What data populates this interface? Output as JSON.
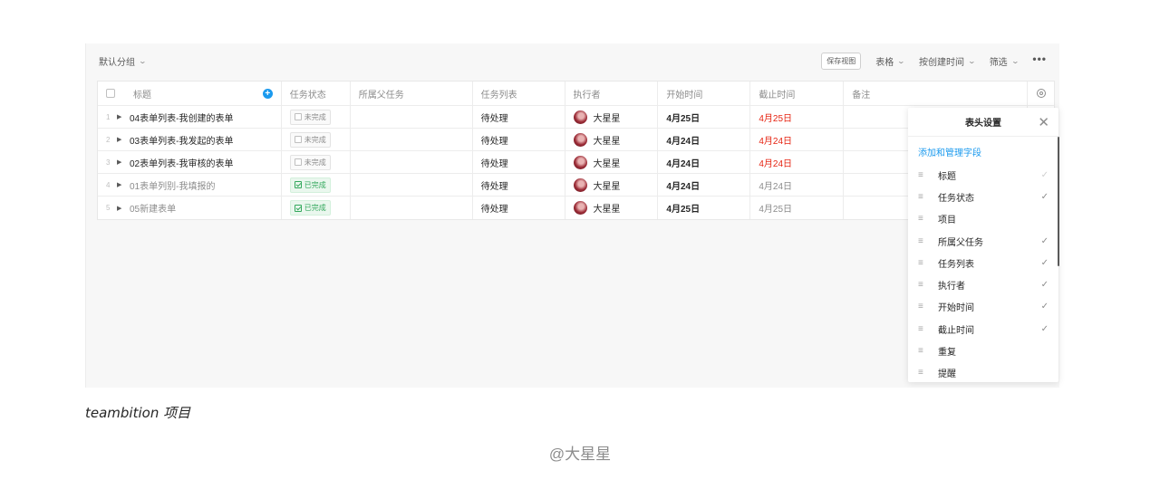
{
  "toolbar": {
    "group_label": "默认分组",
    "save_view": "保存视图",
    "view_type": "表格",
    "sort": "按创建时间",
    "filter": "筛选",
    "more": "•••"
  },
  "columns": [
    "标题",
    "任务状态",
    "所属父任务",
    "任务列表",
    "执行者",
    "开始时间",
    "截止时间",
    "备注"
  ],
  "rows": [
    {
      "num": "1",
      "title": "04表单列表-我创建的表单",
      "status": "未完成",
      "list": "待处理",
      "executor": "大星星",
      "start": "4月25日",
      "due": "4月25日"
    },
    {
      "num": "2",
      "title": "03表单列表-我发起的表单",
      "status": "未完成",
      "list": "待处理",
      "executor": "大星星",
      "start": "4月24日",
      "due": "4月24日"
    },
    {
      "num": "3",
      "title": "02表单列表-我审核的表单",
      "status": "未完成",
      "list": "待处理",
      "executor": "大星星",
      "start": "4月24日",
      "due": "4月24日"
    },
    {
      "num": "4",
      "title": "01表单列别-我填报的",
      "status": "已完成",
      "list": "待处理",
      "executor": "大星星",
      "start": "4月24日",
      "due": "4月24日"
    },
    {
      "num": "5",
      "title": "05新建表单",
      "status": "已完成",
      "list": "待处理",
      "executor": "大星星",
      "start": "4月25日",
      "due": "4月25日"
    }
  ],
  "panel": {
    "title": "表头设置",
    "manage_link": "添加和管理字段",
    "fields": [
      {
        "name": "标题",
        "check": "✓"
      },
      {
        "name": "任务状态",
        "check": "✓"
      },
      {
        "name": "项目",
        "check": ""
      },
      {
        "name": "所属父任务",
        "check": "✓"
      },
      {
        "name": "任务列表",
        "check": "✓"
      },
      {
        "name": "执行者",
        "check": "✓"
      },
      {
        "name": "开始时间",
        "check": "✓"
      },
      {
        "name": "截止时间",
        "check": "✓"
      },
      {
        "name": "重复",
        "check": ""
      },
      {
        "name": "提醒",
        "check": ""
      }
    ]
  },
  "caption": "teambition 项目",
  "credit": "@大星星",
  "colors": {
    "accent": "#1b9aee",
    "overdue": "#e62412",
    "done": "#33a85c"
  }
}
